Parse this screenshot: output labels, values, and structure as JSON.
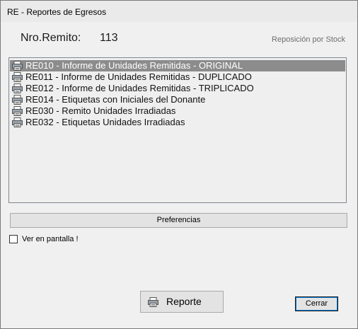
{
  "window": {
    "title": "RE - Reportes de Egresos"
  },
  "header": {
    "remito_label": "Nro.Remito:",
    "remito_value": "113",
    "stock_label": "Reposición por Stock"
  },
  "reports": [
    {
      "label": "RE010 - Informe de Unidades Remitidas - ORIGINAL",
      "icon": "printer-icon",
      "selected": true
    },
    {
      "label": "RE011 - Informe de Unidades Remitidas - DUPLICADO",
      "icon": "printer-icon",
      "selected": false
    },
    {
      "label": "RE012 - Informe de Unidades Remitidas - TRIPLICADO",
      "icon": "printer-icon",
      "selected": false
    },
    {
      "label": "RE014 - Etiquetas con Iniciales del Donante",
      "icon": "printer-icon",
      "selected": false
    },
    {
      "label": "RE030 - Remito Unidades Irradiadas",
      "icon": "printer-icon",
      "selected": false
    },
    {
      "label": "RE032 - Etiquetas Unidades Irradiadas",
      "icon": "printer-icon",
      "selected": false
    }
  ],
  "buttons": {
    "preferences": "Preferencias",
    "report": "Reporte",
    "close": "Cerrar"
  },
  "options": {
    "show_on_screen_label": "Ver en pantalla !",
    "show_on_screen_checked": false
  },
  "colors": {
    "selection": "#8c8c8c",
    "focus_border": "#0078d7"
  }
}
